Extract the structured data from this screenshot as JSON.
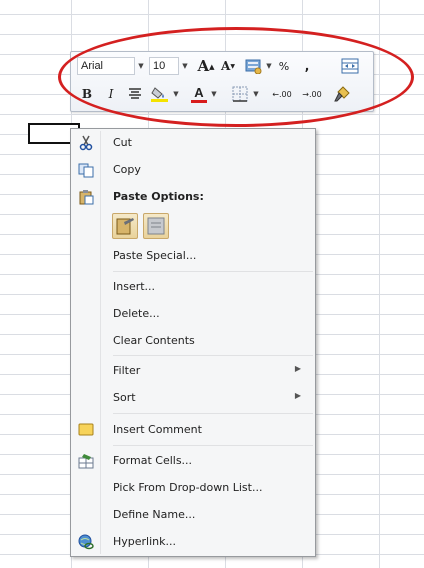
{
  "toolbar": {
    "font_name": "Arial",
    "font_size": "10",
    "grow_font_label": "A",
    "shrink_font_label": "A",
    "percent_label": "%",
    "comma_label": ",",
    "bold_label": "B",
    "italic_label": "I",
    "font_color_label": "A",
    "increase_decimal_label": ".00",
    "decrease_decimal_label": ".00"
  },
  "context_menu": {
    "cut": "Cut",
    "copy": "Copy",
    "paste_options": "Paste Options:",
    "paste_special": "Paste Special...",
    "insert": "Insert...",
    "delete": "Delete...",
    "clear_contents": "Clear Contents",
    "filter": "Filter",
    "sort": "Sort",
    "insert_comment": "Insert Comment",
    "format_cells": "Format Cells...",
    "pick_from_list": "Pick From Drop-down List...",
    "define_name": "Define Name...",
    "hyperlink": "Hyperlink..."
  },
  "colors": {
    "highlight_oval": "#d42020",
    "font_color_bar": "#d81c1c",
    "fill_color_bar": "#f4e300"
  },
  "icons": [
    "scissors-icon",
    "copy-icon",
    "clipboard-icon",
    "comment-icon",
    "format-cells-icon",
    "hyperlink-icon"
  ]
}
